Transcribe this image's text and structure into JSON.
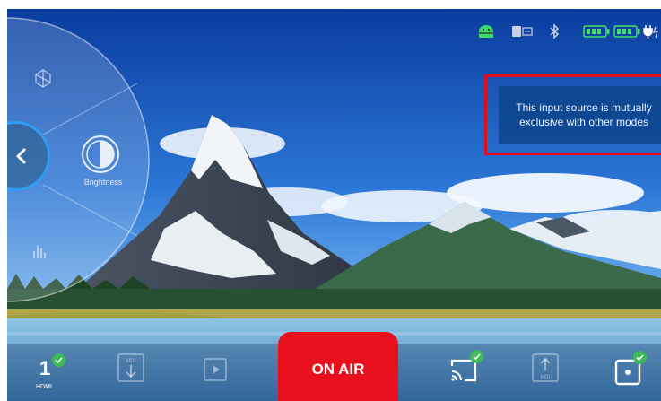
{
  "toast": {
    "message": "This input source is mutually exclusive with other modes"
  },
  "radial_menu": {
    "items": [
      {
        "icon": "display-cube-icon"
      },
      {
        "icon": "brightness-icon",
        "label": "Brightness"
      },
      {
        "icon": "audio-meter-icon"
      }
    ],
    "back_icon": "chevron-left-icon"
  },
  "status_bar": {
    "icons": [
      "android-icon",
      "sd-card-icon",
      "bluetooth-icon",
      "battery-1-icon",
      "battery-2-icon",
      "power-plug-icon"
    ],
    "colors": {
      "android": "#3ddc6a",
      "battery": "#45e066",
      "muted": "#c8d2e2"
    }
  },
  "bottom_bar": {
    "input": {
      "number": "1",
      "label": "HDMI",
      "active": true
    },
    "on_air_label": "ON AIR",
    "buttons": [
      {
        "icon": "ndi-in-icon",
        "text": "NDI",
        "enabled": false
      },
      {
        "icon": "play-icon",
        "enabled": false
      },
      {
        "icon": "screen-cast-icon",
        "active": true
      },
      {
        "icon": "ndi-out-icon",
        "text": "NDI",
        "enabled": false
      },
      {
        "icon": "record-icon",
        "active": true
      }
    ],
    "colors": {
      "on_air": "#ea0f1c",
      "check": "#3dbb59"
    }
  }
}
